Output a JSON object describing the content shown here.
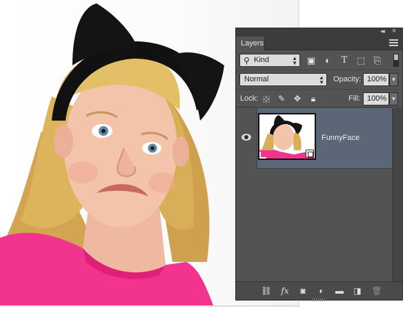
{
  "panel": {
    "tab_label": "Layers",
    "filter": {
      "kind_label": "Kind"
    },
    "blend_mode": "Normal",
    "opacity_label": "Opacity:",
    "opacity_value": "100%",
    "lock_label": "Lock:",
    "fill_label": "Fill:",
    "fill_value": "100%",
    "layers": [
      {
        "name": "FunnyFace",
        "visible": true,
        "smart_object": true
      }
    ],
    "footer_fx_label": "fx"
  },
  "colors": {
    "panel_bg": "#535353",
    "selected_layer": "#5b6677",
    "shirt_pink": "#f2348e",
    "hair_blonde": "#d8b15a",
    "headband_black": "#111111"
  }
}
